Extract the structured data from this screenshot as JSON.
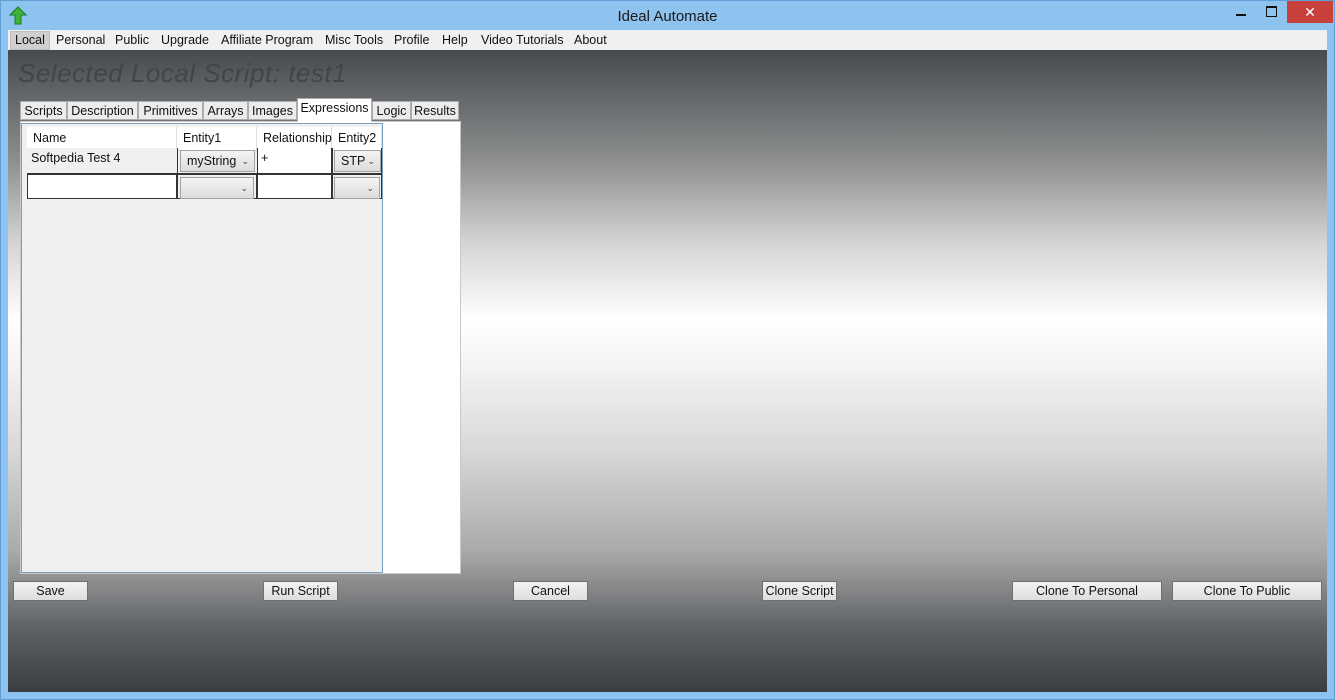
{
  "window": {
    "title": "Ideal Automate",
    "controls": {
      "close": "✕"
    }
  },
  "menu": {
    "items": [
      {
        "label": "Local"
      },
      {
        "label": "Personal"
      },
      {
        "label": "Public"
      },
      {
        "label": "Upgrade"
      },
      {
        "label": "Affiliate Program"
      },
      {
        "label": "Misc Tools"
      },
      {
        "label": "Profile"
      },
      {
        "label": "Help"
      },
      {
        "label": "Video Tutorials"
      },
      {
        "label": "About"
      }
    ]
  },
  "header": {
    "title": "Selected Local Script:  test1"
  },
  "tabs": [
    {
      "label": "Scripts"
    },
    {
      "label": "Description"
    },
    {
      "label": "Primitives"
    },
    {
      "label": "Arrays"
    },
    {
      "label": "Images"
    },
    {
      "label": "Expressions",
      "selected": true
    },
    {
      "label": "Logic"
    },
    {
      "label": "Results"
    }
  ],
  "grid": {
    "columns": [
      "Name",
      "Entity1",
      "Relationship",
      "Entity2"
    ],
    "rows": [
      {
        "name": "Softpedia Test 4",
        "entity1": "myString",
        "relationship": "+",
        "entity2": "STP"
      },
      {
        "name": "",
        "entity1": "",
        "relationship": "",
        "entity2": ""
      }
    ]
  },
  "buttons": {
    "save": "Save",
    "run": "Run Script",
    "cancel": "Cancel",
    "clone": "Clone Script",
    "clone_personal": "Clone To Personal",
    "clone_public": "Clone To Public"
  },
  "colors": {
    "titlebar": "#8ec2ef",
    "close_button": "#c7403a",
    "app_icon": "#3cb43c"
  },
  "icons": {
    "app": "green-up-arrow-icon",
    "dropdown": "chevron-down-icon"
  }
}
